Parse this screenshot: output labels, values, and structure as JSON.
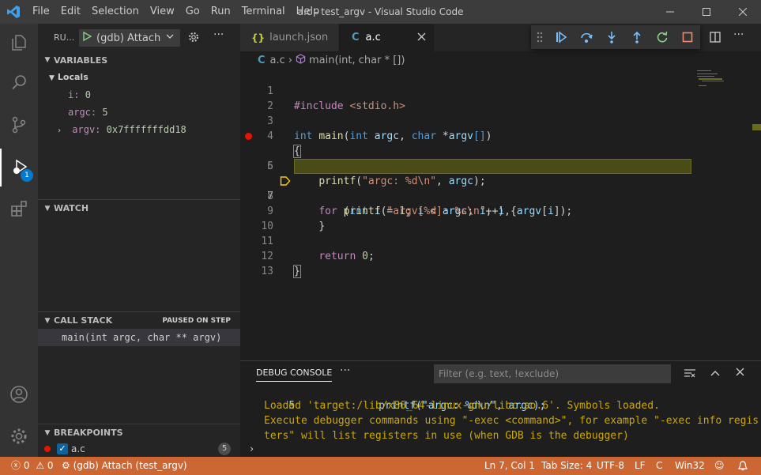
{
  "window": {
    "title": "a.c - test_argv - Visual Studio Code",
    "menu": [
      "File",
      "Edit",
      "Selection",
      "View",
      "Go",
      "Run",
      "Terminal",
      "Help"
    ]
  },
  "sidebar": {
    "run_label": "RU...",
    "launch_config": "(gdb) Attach",
    "variables": {
      "header": "VARIABLES",
      "locals_label": "Locals",
      "items": [
        {
          "name": "i:",
          "value": "0"
        },
        {
          "name": "argc:",
          "value": "5"
        },
        {
          "name": "argv:",
          "value": "0x7fffffffdd18"
        }
      ]
    },
    "watch_header": "WATCH",
    "call_stack": {
      "header": "CALL STACK",
      "status": "PAUSED ON STEP",
      "frames": [
        "main(int argc, char ** argv)"
      ]
    },
    "breakpoints": {
      "header": "BREAKPOINTS",
      "items": [
        {
          "file": "a.c",
          "line": "5"
        }
      ]
    },
    "debug_badge": "1"
  },
  "tabs": [
    {
      "label": "launch.json",
      "icon": "{}"
    },
    {
      "label": "a.c",
      "icon": "C"
    }
  ],
  "breadcrumb": {
    "file": "a.c",
    "symbol": "main(int, char * [])"
  },
  "code": {
    "line_numbers": [
      "1",
      "2",
      "3",
      "4",
      "5",
      "6",
      "7",
      "8",
      "9",
      "10",
      "11",
      "12",
      "13"
    ],
    "tokens": {
      "l1_inc": "#include",
      "l1_hdr": "<stdio.h>",
      "l3_int": "int",
      "l3_main": "main",
      "l3_p1": "(",
      "l3_int2": "int",
      "l3_argc": "argc",
      "l3_c": ",",
      "l3_char": "char",
      "l3_star": "*",
      "l3_argv": "argv",
      "l3_br": "[]",
      "l3_p2": ")",
      "l4": "{",
      "l5_printf": "printf",
      "l5_p1": "(",
      "l5_str": "\"argc: %d\\n\"",
      "l5_c": ",",
      "l5_argc": "argc",
      "l5_end": ");",
      "l7_for": "for",
      "l7_p1": "(",
      "l7_int": "int",
      "l7_i1": "i",
      "l7_eq": "=",
      "l7_one": "1",
      "l7_sc1": ";",
      "l7_i2": "i",
      "l7_lt": "<",
      "l7_argc": "argc",
      "l7_sc2": ";",
      "l7_i3": "i",
      "l7_inc": "++) {",
      "l8_printf": "printf",
      "l8_p1": "(",
      "l8_str": "\"argv[%d]: %s\\n\"",
      "l8_c1": ",",
      "l8_i": "i",
      "l8_c2": ",",
      "l8_argv": "argv",
      "l8_b1": "[",
      "l8_i2": "i",
      "l8_end": "]);",
      "l9": "}",
      "l11_ret": "return",
      "l11_zero": "0",
      "l11_sc": ";",
      "l12": "}"
    }
  },
  "panel": {
    "tab": "DEBUG CONSOLE",
    "filter_placeholder": "Filter (e.g. text, !exclude)",
    "output": {
      "l1_num": "5",
      "l1_code": "printf(\"argc: %d\\n\", argc);",
      "l2": "Loaded 'target:/lib/x86_64-linux-gnu/libc.so.6'. Symbols loaded.",
      "l3": "Execute debugger commands using \"-exec <command>\", for example \"-exec info regis",
      "l4": "ters\" will list registers in use (when GDB is the debugger)"
    }
  },
  "statusbar": {
    "errors": "0",
    "warnings": "0",
    "debug_target": "(gdb) Attach (test_argv)",
    "position": "Ln 7, Col 1",
    "tab_size": "Tab Size: 4",
    "encoding": "UTF-8",
    "eol": "LF",
    "language": "C",
    "platform": "Win32"
  },
  "colors": {
    "accent": "#007acc",
    "statusbar_debug": "#cc6633",
    "breakpoint": "#e51400",
    "current_line": "#4b4b18",
    "warning_text": "#cca700"
  }
}
